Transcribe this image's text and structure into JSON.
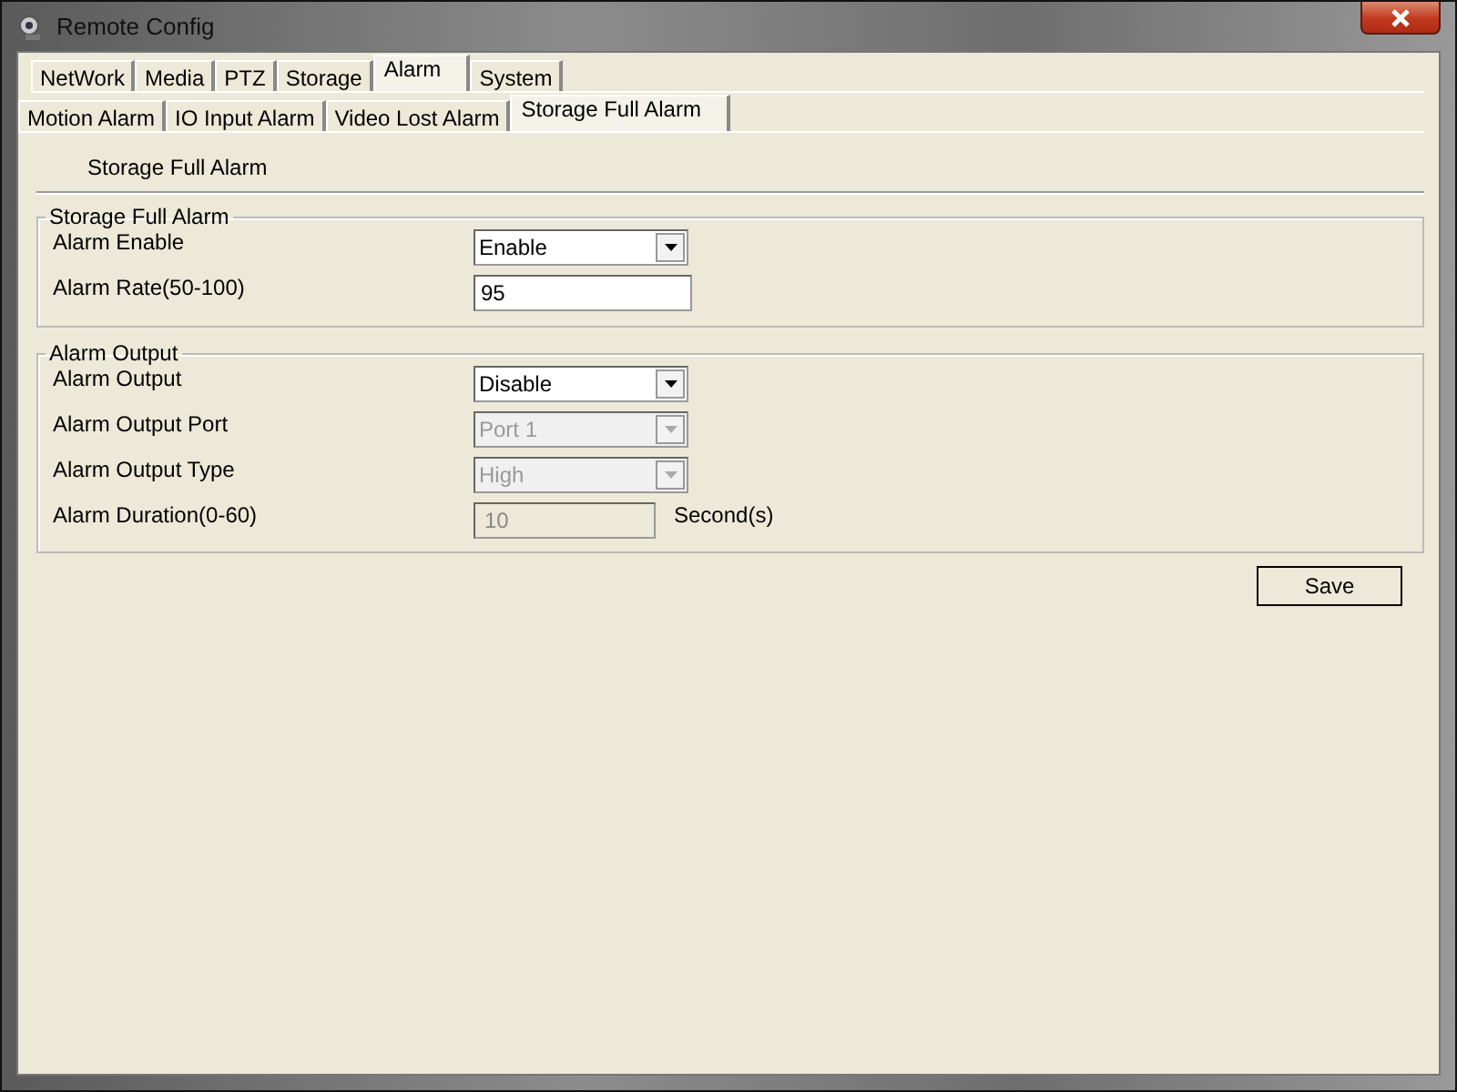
{
  "window": {
    "title": "Remote Config"
  },
  "tabs": [
    {
      "label": "NetWork",
      "selected": false
    },
    {
      "label": "Media",
      "selected": false
    },
    {
      "label": "PTZ",
      "selected": false
    },
    {
      "label": "Storage",
      "selected": false
    },
    {
      "label": "Alarm",
      "selected": true
    },
    {
      "label": "System",
      "selected": false
    }
  ],
  "subtabs": [
    {
      "label": "Motion Alarm",
      "selected": false
    },
    {
      "label": "IO Input Alarm",
      "selected": false
    },
    {
      "label": "Video Lost Alarm",
      "selected": false
    },
    {
      "label": "Storage Full Alarm",
      "selected": true
    }
  ],
  "page_heading": "Storage Full Alarm",
  "groups": [
    {
      "title": "Storage Full Alarm",
      "rows": [
        {
          "label": "Alarm Enable",
          "kind": "select",
          "value": "Enable",
          "disabled": false
        },
        {
          "label": "Alarm Rate(50-100)",
          "kind": "text",
          "value": "95",
          "disabled": false
        }
      ]
    },
    {
      "title": "Alarm Output",
      "rows": [
        {
          "label": "Alarm Output",
          "kind": "select",
          "value": "Disable",
          "disabled": false
        },
        {
          "label": "Alarm Output Port",
          "kind": "select",
          "value": "Port 1",
          "disabled": true
        },
        {
          "label": "Alarm Output Type",
          "kind": "select",
          "value": "High",
          "disabled": true
        },
        {
          "label": "Alarm Duration(0-60)",
          "kind": "text",
          "value": "10",
          "disabled": true,
          "suffix": "Second(s)"
        }
      ]
    }
  ],
  "buttons": [
    "Save"
  ]
}
